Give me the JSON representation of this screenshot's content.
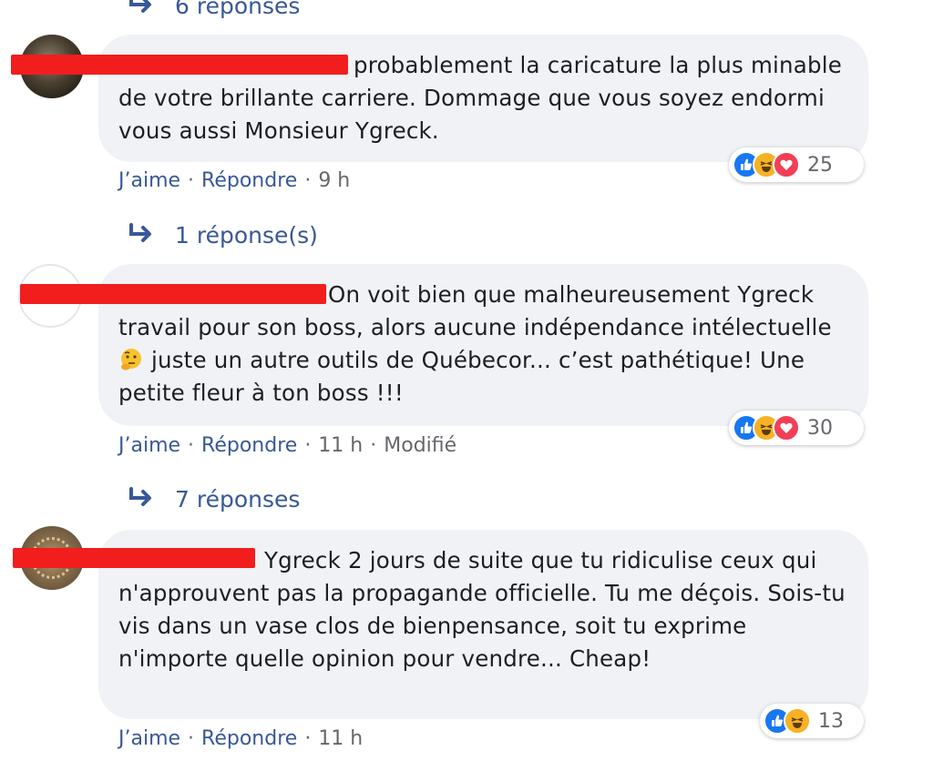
{
  "comments": [
    {
      "text": "probablement la caricature la plus minable de votre brillante carriere. Dommage que vous soyez endormi vous aussi Monsieur Ygreck.",
      "reaction_count": "25",
      "like_label": "J’aime",
      "reply_label": "Répondre",
      "time": "9 h",
      "replies_label": "1 réponse(s)"
    },
    {
      "text_before_emoji": "On voit bien que malheureusement Ygreck travail pour son boss, alors aucune indépendance intélectuelle",
      "text_after_emoji": " juste un autre outils de Québecor... c’est pathétique! Une petite fleur à ton boss !!!",
      "emoji_icon": "thinking-face-emoji",
      "reaction_count": "30",
      "like_label": "J’aime",
      "reply_label": "Répondre",
      "time": "11 h",
      "edited_label": "Modifié",
      "replies_label": "7 réponses"
    },
    {
      "text": "Ygreck 2 jours de suite que tu ridiculise ceux qui n'approuvent pas la propagande officielle. Tu me déçois. Sois-tu vis dans un vase clos de bienpensance, soit tu exprime n'importe quelle opinion pour vendre... Cheap!",
      "reaction_count": "13",
      "like_label": "J’aime",
      "reply_label": "Répondre",
      "time": "11 h"
    }
  ],
  "top_replies_label": "6 réponses",
  "separator": "·",
  "colors": {
    "bubble": "#f0f2f5",
    "link": "#385898",
    "meta": "#65676b",
    "redaction": "#f21d1d",
    "like": "#1877f2",
    "haha": "#f7b125",
    "love": "#f33e58"
  }
}
